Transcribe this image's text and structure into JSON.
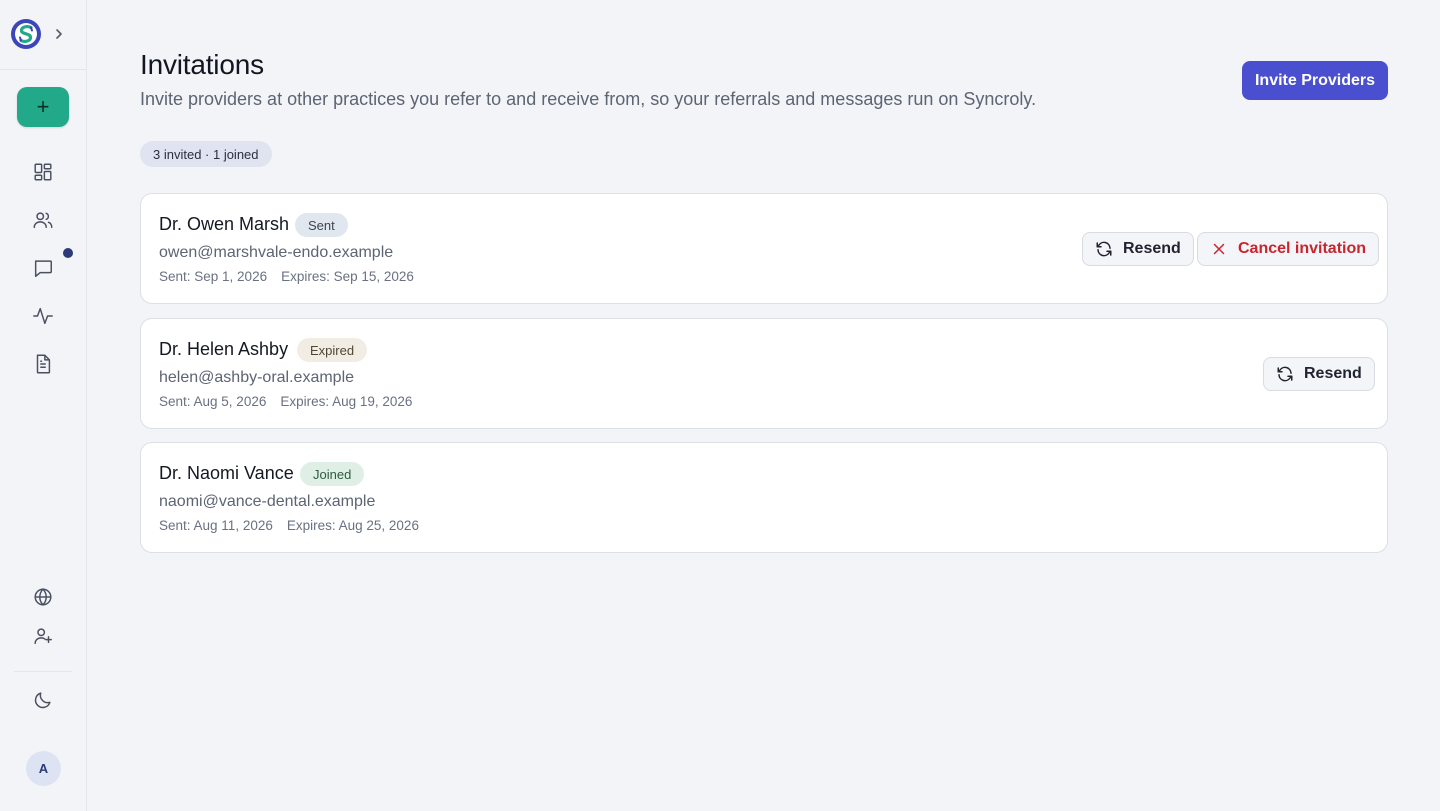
{
  "sidebar": {
    "brand_icon": "syncroly-logo-icon",
    "expand_icon": "chevron-right-icon",
    "new_label": "+",
    "nav": [
      {
        "icon": "dashboard-icon"
      },
      {
        "icon": "users-icon"
      },
      {
        "icon": "messages-icon",
        "has_unread": true
      },
      {
        "icon": "activity-icon"
      },
      {
        "icon": "document-icon"
      }
    ],
    "footer": [
      {
        "icon": "globe-icon"
      },
      {
        "icon": "user-plus-icon"
      },
      {
        "icon": "moon-icon"
      }
    ],
    "avatar_initial": "A"
  },
  "header": {
    "title": "Invitations",
    "subtitle": "Invite providers at other practices you refer to and receive from, so your referrals and messages run on Syncroly.",
    "invite_button": "Invite Providers"
  },
  "summary": "3 invited · 1 joined",
  "invitations": [
    {
      "name": "Dr. Owen Marsh",
      "status": "Sent",
      "email": "owen@marshvale-endo.example",
      "sent": "Sent: Sep 1, 2026",
      "expires": "Expires: Sep 15, 2026",
      "resend_label": "Resend",
      "cancel_label": "Cancel invitation"
    },
    {
      "name": "Dr. Helen Ashby",
      "status": "Expired",
      "email": "helen@ashby-oral.example",
      "sent": "Sent: Aug 5, 2026",
      "expires": "Expires: Aug 19, 2026",
      "resend_label": "Resend"
    },
    {
      "name": "Dr. Naomi Vance",
      "status": "Joined",
      "email": "naomi@vance-dental.example",
      "sent": "Sent: Aug 11, 2026",
      "expires": "Expires: Aug 25, 2026"
    }
  ],
  "colors": {
    "primary": "#4a4fcf",
    "accent_green": "#22a98a",
    "danger": "#c8262f",
    "background": "#f2f4f8"
  }
}
